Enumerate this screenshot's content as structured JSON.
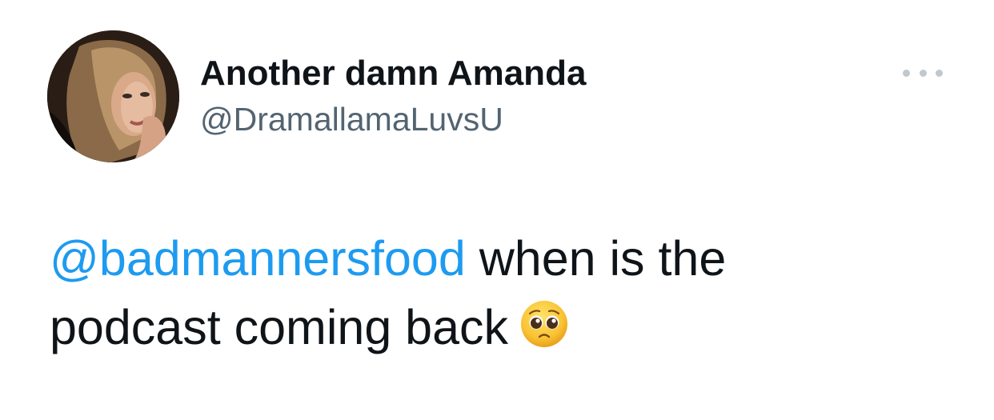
{
  "tweet": {
    "author": {
      "display_name": "Another damn Amanda",
      "handle": "@DramallamaLuvsU"
    },
    "more_icon": "more-horizontal-icon",
    "body": {
      "mention": "@badmannersfood",
      "text_line1": " when is the",
      "text_line2": "podcast coming back",
      "emoji": "pleading-face-emoji"
    }
  },
  "colors": {
    "mention": "#1d9bf0",
    "text": "#0f1419",
    "handle": "#536471",
    "more_dots": "#c1c8ce"
  }
}
